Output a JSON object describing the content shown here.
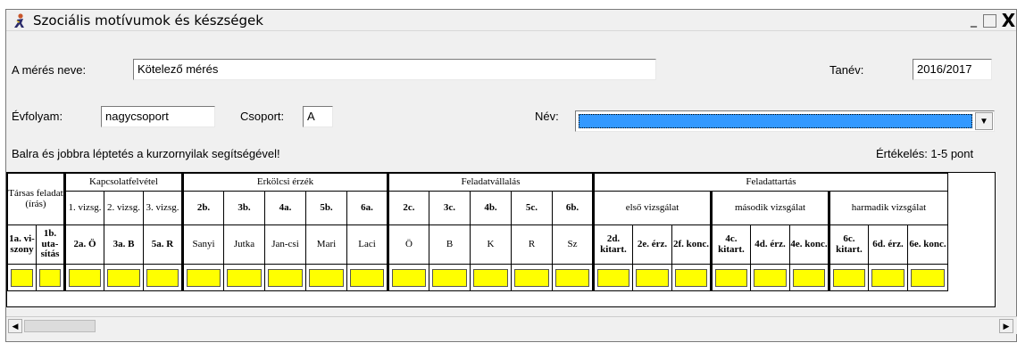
{
  "window": {
    "title": "Szociális motívumok és készségek",
    "min_glyph": "_",
    "max_glyph": "",
    "close_glyph": "X",
    "app_icon": "figure-icon"
  },
  "form": {
    "measurement_label": "A mérés neve:",
    "measurement_value": "Kötelező mérés",
    "year_label": "Tanév:",
    "year_value": "2016/2017",
    "grade_label": "Évfolyam:",
    "grade_value": "nagycsoport",
    "group_label": "Csoport:",
    "group_value": "A",
    "name_label": "Név:",
    "name_value": "",
    "hint": "Balra és jobbra léptetés a kurzornyilak segítségével!",
    "scoring": "Értékelés: 1-5 pont",
    "highlight_color": "#3399ff"
  },
  "grid": {
    "groups": {
      "tarsas": "Társas feladat (írás)",
      "kapcs": "Kapcsolatfelvétel",
      "erkolcsi": "Erkölcsi érzék",
      "feladatvallalas": "Feladatvállalás",
      "feladattartas": "Feladattartás"
    },
    "subgroups": {
      "k1": "1. vizsg.",
      "k2": "2. vizsg.",
      "k3": "3. vizsg.",
      "elso": "első vizsgálat",
      "masodik": "második vizsgálat",
      "harmadik": "harmadik vizsgálat"
    },
    "codes": {
      "c2b": "2b.",
      "c3b": "3b.",
      "c4a": "4a.",
      "c5b": "5b.",
      "c6a": "6a.",
      "c2c": "2c.",
      "c3c": "3c.",
      "c4b": "4b.",
      "c5c": "5c.",
      "c6b": "6b."
    },
    "leaf": {
      "l1a": "1a. vi-szony",
      "l1b": "1b. uta-sítás",
      "l2a": "2a. Ö",
      "l3a": "3a. B",
      "l5a": "5a. R",
      "sanyi": "Sanyi",
      "jutka": "Jutka",
      "jancsi": "Jan-csi",
      "mari": "Mari",
      "laci": "Laci",
      "o": "Ö",
      "b": "B",
      "k": "K",
      "r": "R",
      "sz": "Sz",
      "l2d": "2d. kitart.",
      "l2e": "2e. érz.",
      "l2f": "2f. konc.",
      "l4c": "4c. kitart.",
      "l4d": "4d. érz.",
      "l4e": "4e. konc.",
      "l6c": "6c. kitart.",
      "l6d": "6d. érz.",
      "l6e": "6e. konc."
    },
    "input_color": "#ffff00"
  }
}
